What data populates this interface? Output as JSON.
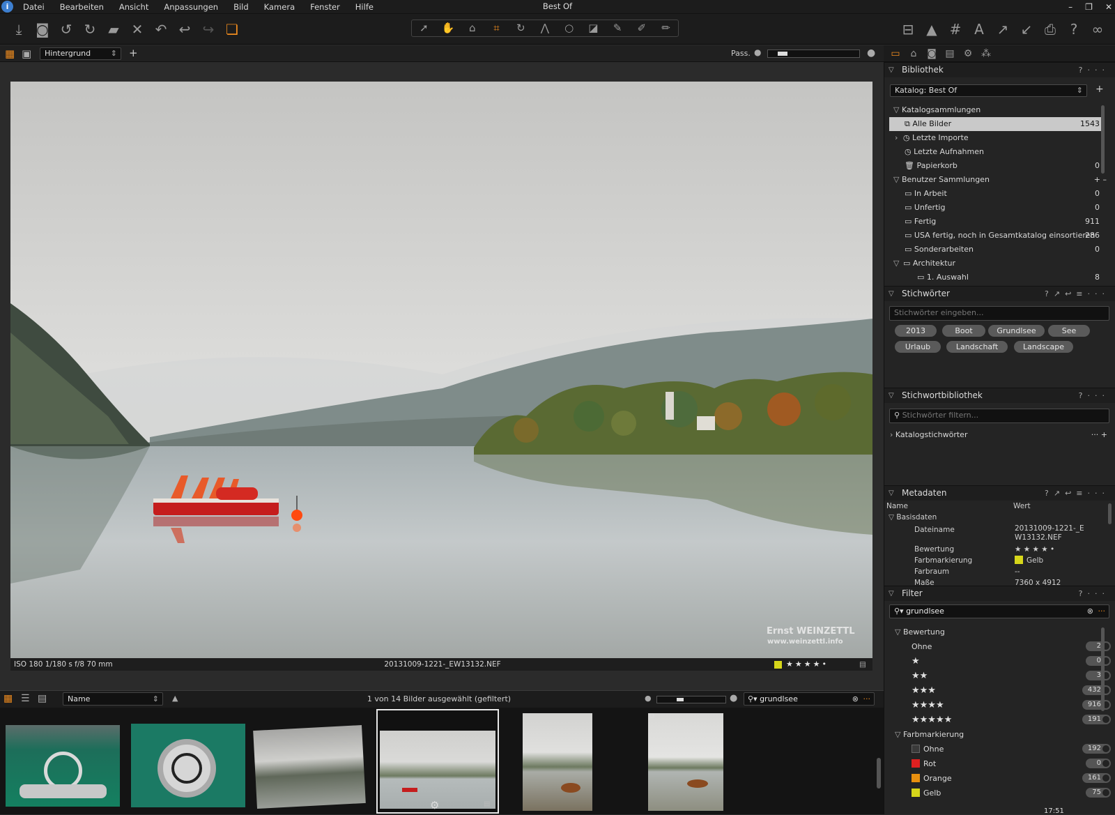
{
  "window": {
    "title": "Best Of"
  },
  "menu": [
    "Datei",
    "Bearbeiten",
    "Ansicht",
    "Anpassungen",
    "Bild",
    "Kamera",
    "Fenster",
    "Hilfe"
  ],
  "viewer": {
    "variant_select": "Hintergrund",
    "pass_label": "Pass.",
    "exif": "ISO 180  1/180 s  f/8  70 mm",
    "filename": "20131009-1221-_EW13132.NEF",
    "watermark_line1": "Ernst WEINZETTL",
    "watermark_line2": "www.weinzettl.info"
  },
  "browser": {
    "sort_select": "Name",
    "status": "1 von 14 Bilder ausgewählt (gefiltert)",
    "search_value": "grundlsee"
  },
  "library": {
    "title": "Bibliothek",
    "catalog_select": "Katalog: Best Of",
    "catalog_collections_label": "Katalogsammlungen",
    "catalog_items": [
      {
        "label": "Alle Bilder",
        "count": "1543"
      },
      {
        "label": "Letzte Importe",
        "count": ""
      },
      {
        "label": "Letzte Aufnahmen",
        "count": ""
      },
      {
        "label": "Papierkorb",
        "count": "0"
      }
    ],
    "user_collections_label": "Benutzer Sammlungen",
    "user_items": [
      {
        "label": "In Arbeit",
        "count": "0"
      },
      {
        "label": "Unfertig",
        "count": "0"
      },
      {
        "label": "Fertig",
        "count": "911"
      },
      {
        "label": "USA fertig, noch in Gesamtkatalog einsortieren",
        "count": "286"
      },
      {
        "label": "Sonderarbeiten",
        "count": "0"
      },
      {
        "label": "Architektur",
        "count": ""
      },
      {
        "label": "1. Auswahl",
        "count": "8"
      }
    ]
  },
  "keywords": {
    "title": "Stichwörter",
    "placeholder": "Stichwörter eingeben...",
    "tags": [
      "2013",
      "Boot",
      "Grundlsee",
      "See",
      "Urlaub",
      "Landschaft",
      "Landscape"
    ]
  },
  "keyword_library": {
    "title": "Stichwortbibliothek",
    "placeholder": "Stichwörter filtern...",
    "catalog_keywords": "Katalogstichwörter"
  },
  "metadata": {
    "title": "Metadaten",
    "col_name": "Name",
    "col_value": "Wert",
    "group": "Basisdaten",
    "rows": [
      {
        "name": "Dateiname",
        "value": "20131009-1221-_EW13132.NEF"
      },
      {
        "name": "Bewertung",
        "value": "★ ★ ★ ★ •"
      },
      {
        "name": "Farbmarkierung",
        "value": "Gelb"
      },
      {
        "name": "Farbraum",
        "value": "--"
      },
      {
        "name": "Maße",
        "value": "7360 x 4912"
      }
    ]
  },
  "filter": {
    "title": "Filter",
    "search_value": "grundlsee",
    "rating_label": "Bewertung",
    "ratings": [
      {
        "label": "Ohne",
        "count": "2"
      },
      {
        "label": "★",
        "count": "0"
      },
      {
        "label": "★★",
        "count": "3"
      },
      {
        "label": "★★★",
        "count": "432"
      },
      {
        "label": "★★★★",
        "count": "916"
      },
      {
        "label": "★★★★★",
        "count": "191"
      }
    ],
    "color_label": "Farbmarkierung",
    "colors": [
      {
        "label": "Ohne",
        "count": "192",
        "swatch": "#3a3a3a"
      },
      {
        "label": "Rot",
        "count": "0",
        "swatch": "#e02020"
      },
      {
        "label": "Orange",
        "count": "161",
        "swatch": "#e8900f"
      },
      {
        "label": "Gelb",
        "count": "75",
        "swatch": "#d6d61a"
      }
    ]
  },
  "accent_color": "#f08c1e",
  "status": {
    "clock": "17:51"
  }
}
